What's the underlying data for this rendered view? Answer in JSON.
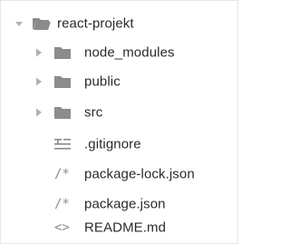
{
  "explorer": {
    "root": {
      "label": "react-projekt",
      "expanded": true,
      "icon": "folder-open-icon"
    },
    "folders": [
      {
        "label": "node_modules",
        "icon": "folder-icon",
        "expanded": false
      },
      {
        "label": "public",
        "icon": "folder-icon",
        "expanded": false
      },
      {
        "label": "src",
        "icon": "folder-icon",
        "expanded": false
      }
    ],
    "files": [
      {
        "label": ".gitignore",
        "icon": "lines-icon"
      },
      {
        "label": "package-lock.json",
        "icon": "json-icon",
        "glyph": "/*"
      },
      {
        "label": "package.json",
        "icon": "json-icon",
        "glyph": "/*"
      },
      {
        "label": "README.md",
        "icon": "markdown-icon",
        "glyph": "<>"
      }
    ]
  },
  "colors": {
    "text": "#2a2a2a",
    "icon_gray": "#8a8a8a",
    "folder_gray": "#8c8c8c",
    "chevron_gray": "#b0b0b0",
    "border": "#e6e6e6"
  }
}
